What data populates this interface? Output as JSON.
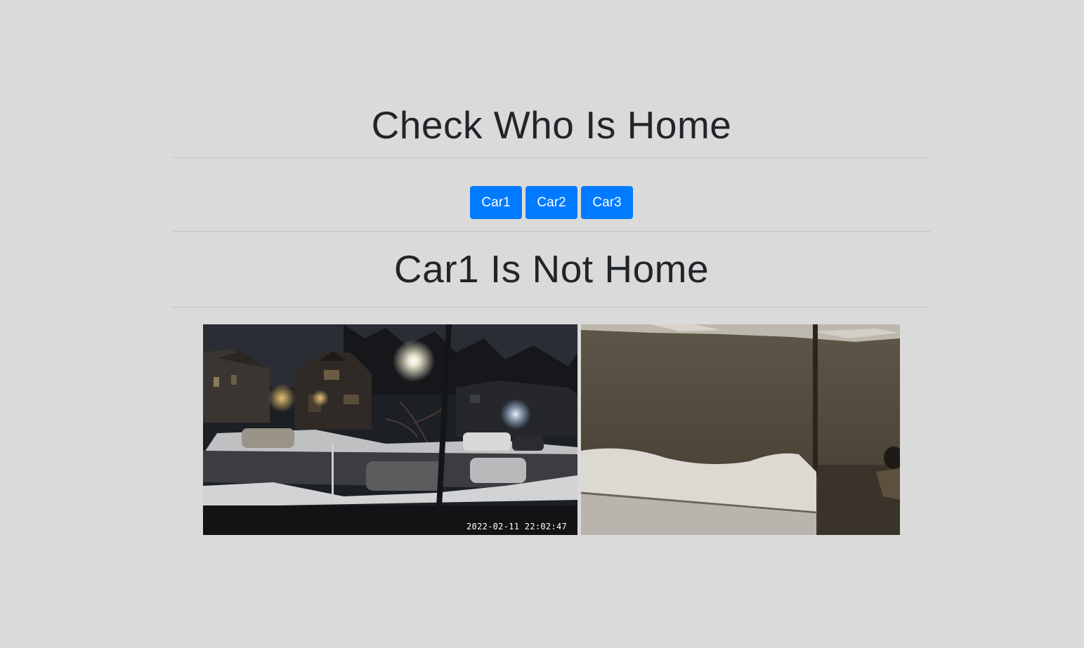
{
  "header": {
    "title": "Check Who Is Home"
  },
  "buttons": {
    "car1": "Car1",
    "car2": "Car2",
    "car3": "Car3"
  },
  "status": {
    "message": "Car1 Is Not Home"
  },
  "cameras": {
    "cam1": {
      "timestamp": "2022-02-11 22:02:47"
    }
  },
  "colors": {
    "background": "#dadada",
    "button": "#007bff",
    "button_text": "#ffffff",
    "text": "#212529"
  }
}
